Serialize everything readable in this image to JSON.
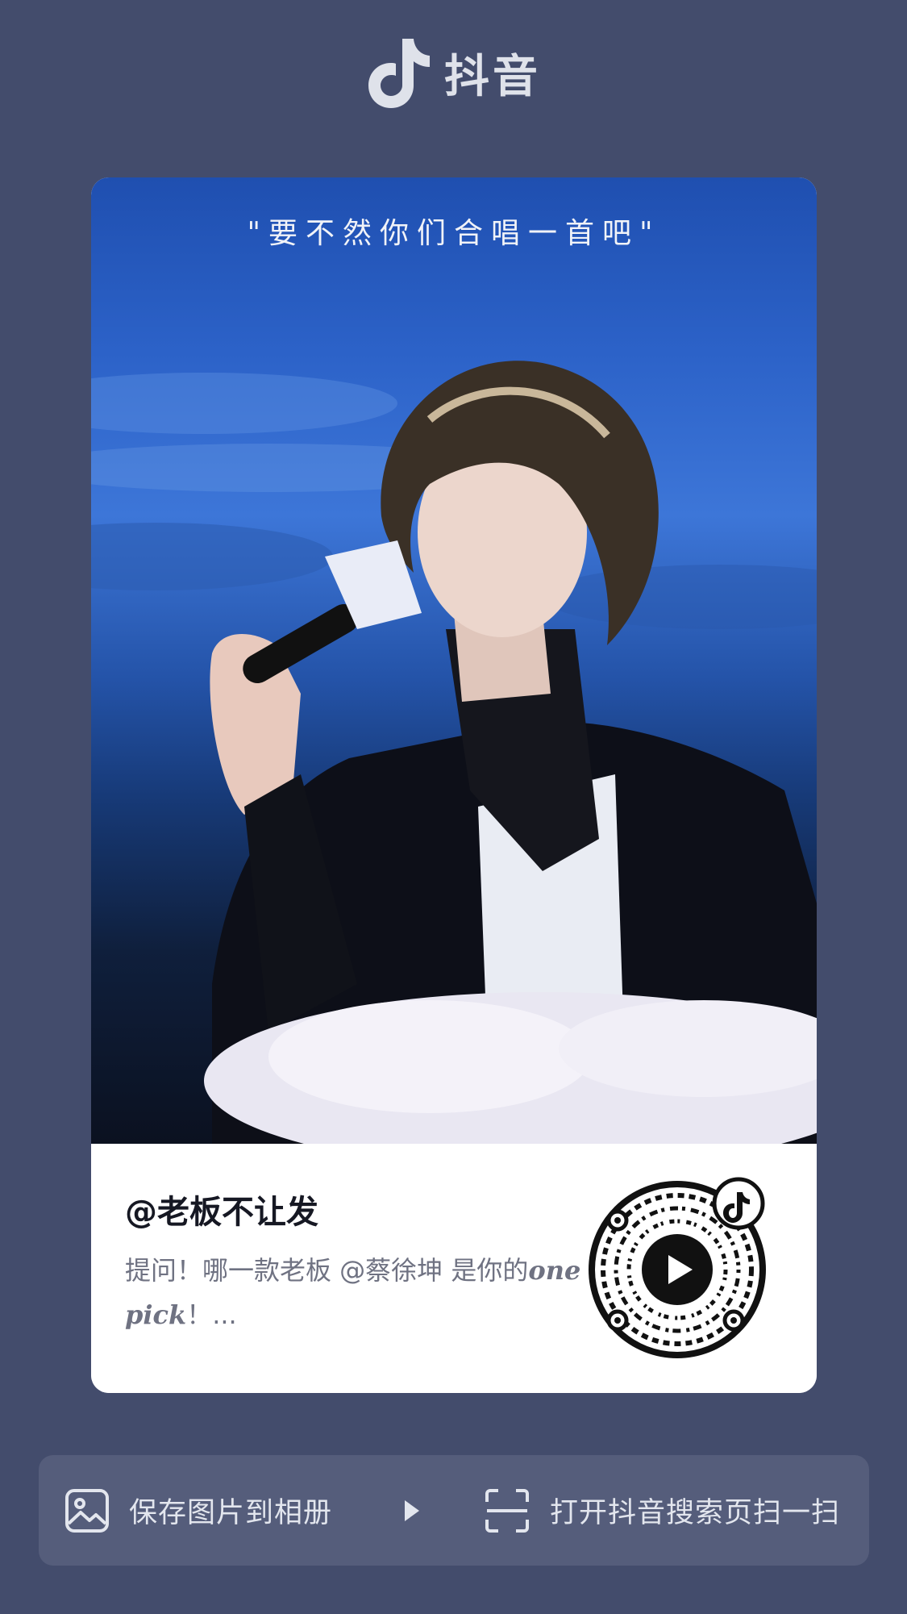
{
  "app": {
    "name": "抖音"
  },
  "card": {
    "caption": "\"要不然你们合唱一首吧\"",
    "author": "@老板不让发",
    "description_prefix": "提问！哪一款老板 @蔡徐坤 是你的",
    "description_emph": "one pick",
    "description_suffix": "！..."
  },
  "actions": {
    "save_label": "保存图片到相册",
    "scan_label": "打开抖音搜索页扫一扫"
  },
  "icons": [
    "douyin-logo-icon",
    "image-icon",
    "play-triangle-icon",
    "scan-icon",
    "qr-code",
    "play-icon"
  ],
  "colors": {
    "background": "#434c6c",
    "bar": "#555d7b",
    "card": "#ffffff"
  }
}
